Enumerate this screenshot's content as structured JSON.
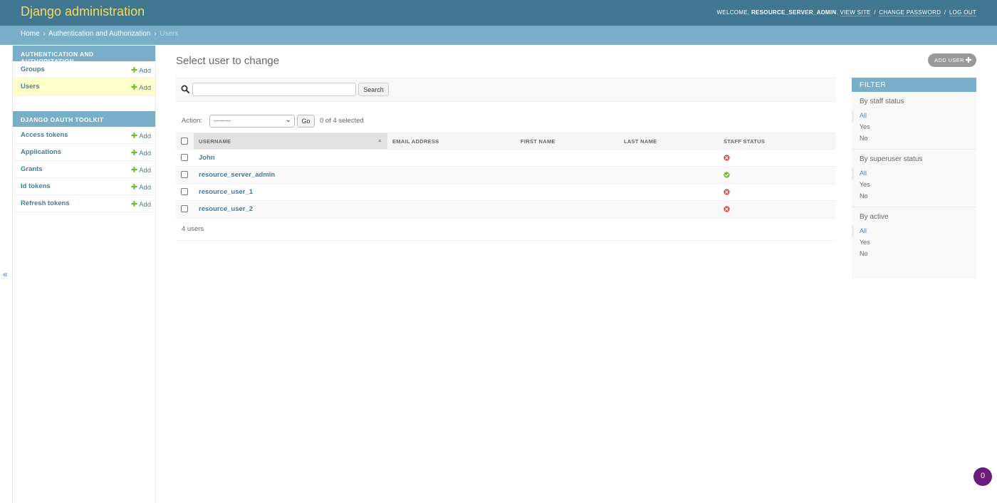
{
  "header": {
    "site_title": "Django administration",
    "welcome": "WELCOME,",
    "username": "RESOURCE_SERVER_ADMIN",
    "links": [
      "VIEW SITE",
      "CHANGE PASSWORD",
      "LOG OUT"
    ],
    "bg_color": "#417690"
  },
  "breadcrumbs": {
    "home": "Home",
    "section": "Authentication and Authorization",
    "current": "Users"
  },
  "sidebar": {
    "modules": [
      {
        "caption": "Authentication and Authorization",
        "rows": [
          {
            "label": "Groups",
            "add": "Add"
          },
          {
            "label": "Users",
            "add": "Add"
          }
        ]
      },
      {
        "caption": "Django OAuth Toolkit",
        "rows": [
          {
            "label": "Access tokens",
            "add": "Add"
          },
          {
            "label": "Applications",
            "add": "Add"
          },
          {
            "label": "Grants",
            "add": "Add"
          },
          {
            "label": "Id tokens",
            "add": "Add"
          },
          {
            "label": "Refresh tokens",
            "add": "Add"
          }
        ]
      }
    ],
    "toggle": "«"
  },
  "content": {
    "title": "Select user to change",
    "add_button": "Add user",
    "search_button": "Search",
    "search_value": "",
    "action_label": "Action:",
    "action_value": "---------",
    "go_button": "Go",
    "selection_count": "0 of 4 selected",
    "columns": [
      "Username",
      "Email address",
      "First name",
      "Last name",
      "Staff status"
    ],
    "rows": [
      {
        "username": "John",
        "email": "",
        "first_name": "",
        "last_name": "",
        "staff": false
      },
      {
        "username": "resource_server_admin",
        "email": "",
        "first_name": "",
        "last_name": "",
        "staff": true
      },
      {
        "username": "resource_user_1",
        "email": "",
        "first_name": "",
        "last_name": "",
        "staff": false
      },
      {
        "username": "resource_user_2",
        "email": "",
        "first_name": "",
        "last_name": "",
        "staff": false
      }
    ],
    "paginator": "4 users"
  },
  "filter": {
    "title": "FILTER",
    "groups": [
      {
        "heading": "By staff status",
        "options": [
          "All",
          "Yes",
          "No"
        ],
        "selected": "All"
      },
      {
        "heading": "By superuser status",
        "options": [
          "All",
          "Yes",
          "No"
        ],
        "selected": "All"
      },
      {
        "heading": "By active",
        "options": [
          "All",
          "Yes",
          "No"
        ],
        "selected": "All"
      }
    ]
  },
  "badge": {
    "value": "0"
  },
  "colors": {
    "accent": "#79aec8",
    "link": "#447e9b",
    "add_green": "#70bf2b",
    "yes_green": "#70bf2b",
    "no_red": "#dd4646",
    "badge": "#6b1a7e"
  }
}
